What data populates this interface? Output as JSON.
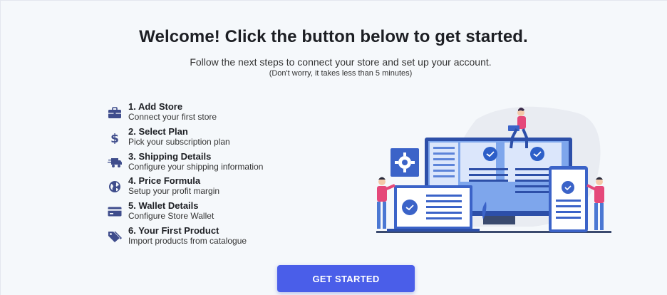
{
  "header": {
    "title": "Welcome! Click the button below to get started.",
    "subtitle": "Follow the next steps to connect your store and set up your account.",
    "note": "(Don't worry, it takes less than 5 minutes)"
  },
  "steps": [
    {
      "title": "1. Add Store",
      "description": "Connect your first store",
      "icon": "briefcase-icon"
    },
    {
      "title": "2. Select Plan",
      "description": "Pick your subscription plan",
      "icon": "dollar-icon"
    },
    {
      "title": "3. Shipping Details",
      "description": "Configure your shipping information",
      "icon": "truck-icon"
    },
    {
      "title": "4. Price Formula",
      "description": "Setup your profit margin",
      "icon": "globe-icon"
    },
    {
      "title": "5. Wallet Details",
      "description": "Configure Store Wallet",
      "icon": "credit-card-icon"
    },
    {
      "title": "6. Your First Product",
      "description": "Import products from catalogue",
      "icon": "tags-icon"
    }
  ],
  "cta": {
    "label": "GET STARTED"
  },
  "colors": {
    "accent": "#4a5ee9",
    "icon": "#3f4d8c",
    "illustration_primary": "#3b63c8",
    "illustration_pink": "#e5487a",
    "background": "#f5f8fb"
  }
}
